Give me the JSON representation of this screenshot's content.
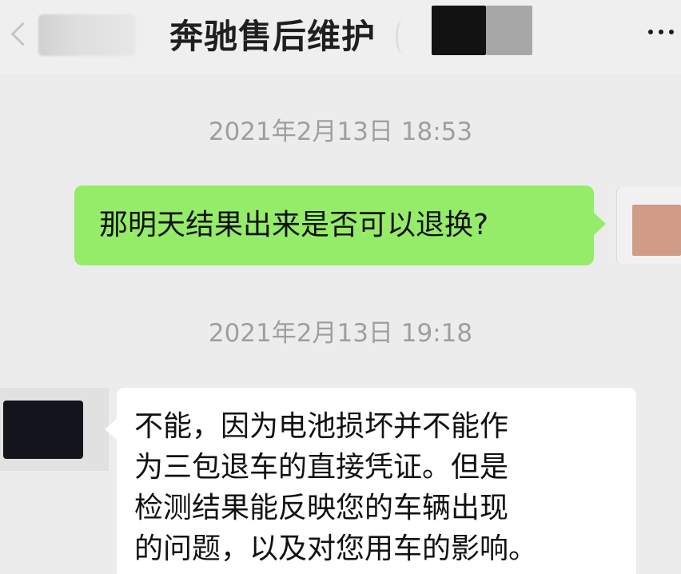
{
  "header": {
    "title": "奔驰售后维护"
  },
  "messages": [
    {
      "timestamp": "2021年2月13日 18:53",
      "text": "那明天结果出来是否可以退换?"
    },
    {
      "timestamp": "2021年2月13日 19:18",
      "lines": [
        "不能，因为电池损坏并不能作",
        "为三包退车的直接凭证。但是",
        "检测结果能反映您的车辆出现",
        "的问题，以及对您用车的影响。"
      ]
    }
  ],
  "colors": {
    "background": "#ececec",
    "outgoing_bubble": "#95ec69",
    "incoming_bubble": "#ffffff",
    "timestamp_text": "#9f9f9f"
  },
  "icons": {
    "back": "chevron-left-icon",
    "more": "more-horizontal-icon"
  }
}
